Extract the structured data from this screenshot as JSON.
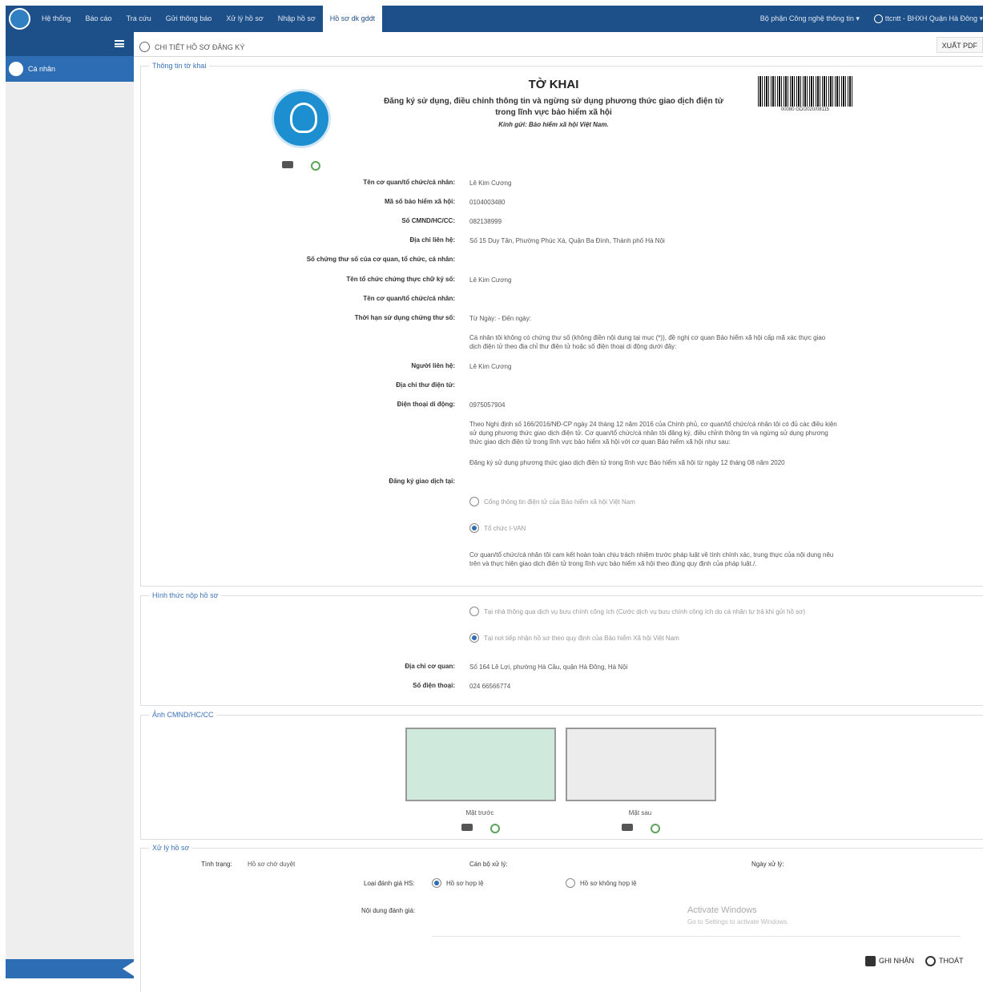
{
  "nav": {
    "items": [
      "Hệ thống",
      "Báo cáo",
      "Tra cứu",
      "Gửi thông báo",
      "Xử lý hồ sơ",
      "Nhập hồ sơ",
      "Hồ sơ dk gddt"
    ],
    "department": "Bộ phận Công nghệ thông tin ▾",
    "user": "ttcntt - BHXH Quận Hà Đông ▾"
  },
  "sidebar": {
    "item": "Cá nhân"
  },
  "breadcrumb": "CHI TIẾT HỒ SƠ ĐĂNG KÝ",
  "export_pdf": "XUẤT PDF",
  "sections": {
    "s1": "Thông tin tờ khai",
    "s2": "Hình thức nộp hồ sơ",
    "s3": "Ảnh CMND/HC/CC",
    "s4": "Xử lý hồ sơ"
  },
  "form": {
    "title": "TỜ KHAI",
    "subtitle": "Đăng ký sử dụng, điều chỉnh thông tin và ngừng sử dụng phương thức giao dịch điện tử trong lĩnh vực bảo hiểm xã hội",
    "recipient": "Kính gửi: Bảo hiểm xã hội Việt Nam.",
    "barcode_text": "00080 GD/2020/08115"
  },
  "fields": [
    {
      "label": "Tên cơ quan/tổ chức/cá nhân:",
      "value": "Lê Kim Cương"
    },
    {
      "label": "Mã số bảo hiểm xã hội:",
      "value": "0104003480"
    },
    {
      "label": "Số CMND/HC/CC:",
      "value": "082138999"
    },
    {
      "label": "Địa chỉ liên hệ:",
      "value": "Số 15 Duy Tân, Phường Phúc Xá, Quận Ba Đình, Thành phố Hà Nội"
    },
    {
      "label": "Số chứng thư số của cơ quan, tổ chức, cá nhân:",
      "value": ""
    },
    {
      "label": "Tên tổ chức chứng thực chữ ký số:",
      "value": "Lê Kim Cương"
    },
    {
      "label": "Tên cơ quan/tổ chức/cá nhân:",
      "value": ""
    },
    {
      "label": "Thời hạn sử dụng chứng thư số:",
      "value": "Từ Ngày: - Đến ngày:"
    }
  ],
  "note1": "Cá nhân tôi không có chứng thư số (không điền nội dung tại mục (*)), đề nghị cơ quan Bảo hiểm xã hội cấp mã xác thực giao dịch điện tử theo địa chỉ thư điện tử hoặc số điện thoại di động dưới đây:",
  "contact": [
    {
      "label": "Người liên hệ:",
      "value": "Lê Kim Cương"
    },
    {
      "label": "Địa chỉ thư điện tử:",
      "value": ""
    },
    {
      "label": "Điện thoại di động:",
      "value": "0975057904"
    }
  ],
  "note2": "Theo Nghị định số 166/2016/NĐ-CP ngày 24 tháng 12 năm 2016 của Chính phủ, cơ quan/tổ chức/cá nhân tôi có đủ các điều kiện sử dụng phương thức giao dịch điện tử. Cơ quan/tổ chức/cá nhân tôi đăng ký, điều chỉnh thông tin và ngừng sử dụng phương thức giao dịch điện tử trong lĩnh vực bảo hiểm xã hội với cơ quan Bảo hiểm xã hội như sau:",
  "note3": "Đăng ký sử dụng phương thức giao dịch điện tử trong lĩnh vực Bảo hiểm xã hội từ ngày 12 tháng 08 năm 2020",
  "register_label": "Đăng ký giao dịch tại:",
  "register_options": [
    "Cổng thông tin điện tử của Bảo hiểm xã hội Việt Nam",
    "Tổ chức I-VAN"
  ],
  "commit": "Cơ quan/tổ chức/cá nhân tôi cam kết hoàn toàn chịu trách nhiệm trước pháp luật về tính chính xác, trung thực của nội dung nêu trên và thực hiện giao dịch điện tử trong lĩnh vực bảo hiểm xã hội theo đúng quy định của pháp luật./.",
  "submit_options": [
    "Tại nhà thông qua dịch vụ bưu chính công ích (Cước dịch vụ bưu chính công ích do cá nhân tự trả khi gửi hồ sơ)",
    "Tại nơi tiếp nhận hồ sơ theo quy định của Bảo hiểm Xã hội Việt Nam"
  ],
  "office": [
    {
      "label": "Địa chỉ cơ quan:",
      "value": "Số 164 Lê Lợi, phường Hà Cầu, quận Hà Đông, Hà Nội"
    },
    {
      "label": "Số điện thoại:",
      "value": "024 66566774"
    }
  ],
  "id_images": {
    "front": "Mặt trước",
    "back": "Mặt sau"
  },
  "process": {
    "status_label": "Tình trạng:",
    "status_value": "Hồ sơ chờ duyệt",
    "officer_label": "Cán bộ xử lý:",
    "date_label": "Ngày xử lý:",
    "eval_label": "Loại đánh giá HS:",
    "eval_options": [
      "Hồ sơ hợp lệ",
      "Hồ sơ không hợp lệ"
    ],
    "content_label": "Nội dung đánh giá:"
  },
  "buttons": {
    "save": "GHI NHẬN",
    "exit": "THOÁT"
  },
  "watermark": {
    "line1": "Activate Windows",
    "line2": "Go to Settings to activate Windows."
  }
}
